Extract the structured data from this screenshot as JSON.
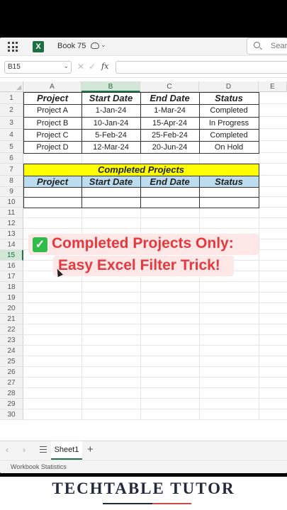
{
  "titlebar": {
    "app_logo": "X",
    "book_title": "Book 75",
    "search_placeholder": "Search"
  },
  "formula_bar": {
    "name_box": "B15",
    "fx": "fx"
  },
  "columns": [
    "A",
    "B",
    "C",
    "D",
    "E"
  ],
  "selected_column": "B",
  "rows": [
    "1",
    "2",
    "3",
    "4",
    "5",
    "6",
    "7",
    "8",
    "9",
    "10",
    "11",
    "12",
    "13",
    "14",
    "15",
    "16",
    "17",
    "18",
    "19",
    "20",
    "21",
    "22",
    "23",
    "24",
    "25",
    "26",
    "27",
    "28",
    "29",
    "30"
  ],
  "selected_row": "15",
  "table1": {
    "headers": [
      "Project",
      "Start Date",
      "End Date",
      "Status"
    ],
    "rows": [
      [
        "Project A",
        "1-Jan-24",
        "1-Mar-24",
        "Completed"
      ],
      [
        "Project B",
        "10-Jan-24",
        "15-Apr-24",
        "In Progress"
      ],
      [
        "Project C",
        "5-Feb-24",
        "25-Feb-24",
        "Completed"
      ],
      [
        "Project D",
        "12-Mar-24",
        "20-Jun-24",
        "On Hold"
      ]
    ]
  },
  "table2": {
    "title": "Completed Projects",
    "headers": [
      "Project",
      "Start Date",
      "End Date",
      "Status"
    ]
  },
  "caption": {
    "line1": "Completed Projects Only:",
    "line2": "Easy Excel Filter Trick!"
  },
  "sheet_tabs": {
    "active": "Sheet1"
  },
  "status_bar": {
    "text": "Workbook Statistics"
  },
  "brand": {
    "name": "TECHTABLE TUTOR"
  },
  "colors": {
    "excel_green": "#217346",
    "highlight_yellow": "#ffff00",
    "header_blue": "#bcdcef",
    "caption_red": "#e6383d",
    "caption_bg": "#fde7e7"
  }
}
